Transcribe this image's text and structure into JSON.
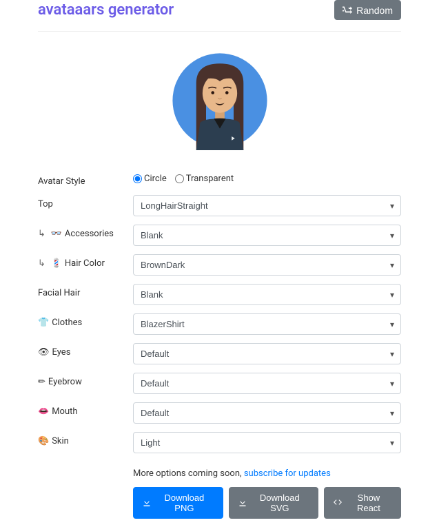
{
  "header": {
    "title": "avataaars generator",
    "random_label": "Random"
  },
  "form": {
    "avatar_style": {
      "label": "Avatar Style",
      "options": {
        "circle": "Circle",
        "transparent": "Transparent"
      },
      "selected": "circle"
    },
    "top": {
      "label": "Top",
      "value": "LongHairStraight"
    },
    "accessories": {
      "label": "Accessories",
      "prefix": "↳ 👓",
      "value": "Blank"
    },
    "hair_color": {
      "label": "Hair Color",
      "prefix": "↳ 💈",
      "value": "BrownDark"
    },
    "facial_hair": {
      "label": "Facial Hair",
      "value": "Blank"
    },
    "clothes": {
      "label": "Clothes",
      "icon": "👕",
      "value": "BlazerShirt"
    },
    "eyes": {
      "label": "Eyes",
      "icon": "👁",
      "value": "Default"
    },
    "eyebrow": {
      "label": "Eyebrow",
      "icon": "✏",
      "value": "Default"
    },
    "mouth": {
      "label": "Mouth",
      "icon": "👄",
      "value": "Default"
    },
    "skin": {
      "label": "Skin",
      "icon": "🎨",
      "value": "Light"
    }
  },
  "footer": {
    "more_text": "More options coming soon, ",
    "subscribe_link": "subscribe for updates",
    "download_png": "Download PNG",
    "download_svg": "Download SVG",
    "show_react": "Show React"
  }
}
